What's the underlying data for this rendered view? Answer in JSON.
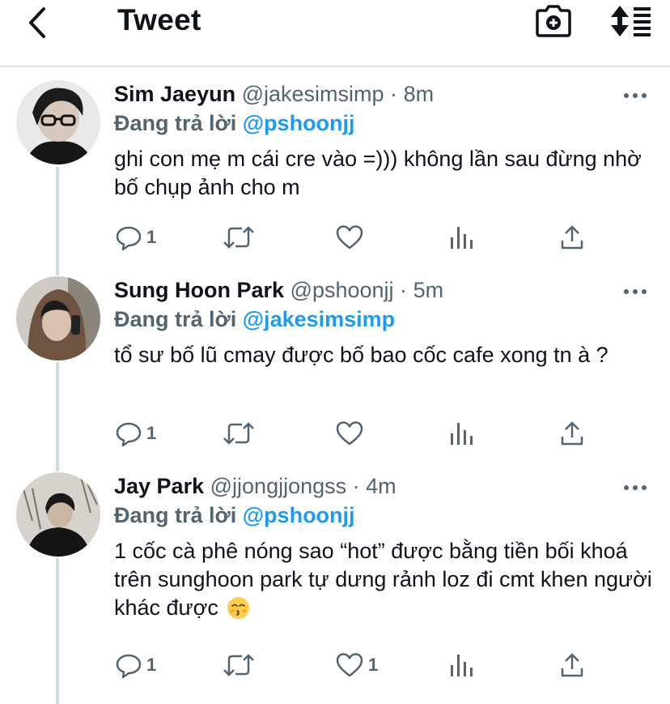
{
  "header": {
    "title": "Tweet"
  },
  "icons": {
    "back": "chevron-left-icon",
    "camera": "camera-plus-icon",
    "sort": "sort-icon",
    "more": "more-dots-icon",
    "reply": "reply-icon",
    "retweet": "retweet-icon",
    "like": "heart-icon",
    "analytics": "analytics-icon",
    "share": "share-icon"
  },
  "colors": {
    "link": "#1d9bf0",
    "muted": "#536471",
    "text": "#0f1419"
  },
  "tweets": [
    {
      "name": "Sim Jaeyun",
      "handle": "@jakesimsimp",
      "dot": "·",
      "time": "8m",
      "reply_prefix": "Đang trả lời",
      "reply_to": "@pshoonjj",
      "text": "ghi con mẹ m cái cre vào =))) không lần sau đừng nhờ bố chụp ảnh cho m",
      "emoji": "",
      "reply_count": "1",
      "like_count": ""
    },
    {
      "name": "Sung Hoon Park",
      "handle": "@pshoonjj",
      "dot": "·",
      "time": "5m",
      "reply_prefix": "Đang trả lời",
      "reply_to": "@jakesimsimp",
      "text": "tổ sư bố lũ cmay được bố bao cốc cafe xong tn à ?",
      "emoji": "",
      "reply_count": "1",
      "like_count": ""
    },
    {
      "name": "Jay Park",
      "handle": "@jjongjjongss",
      "dot": "·",
      "time": "4m",
      "reply_prefix": "Đang trả lời",
      "reply_to": "@pshoonjj",
      "text": "1 cốc cà phê nóng sao “hot” được bằng tiền bối khoá trên sunghoon park tự dưng rảnh loz đi cmt khen người khác được",
      "emoji": "kissing-face-emoji",
      "reply_count": "1",
      "like_count": "1"
    }
  ]
}
